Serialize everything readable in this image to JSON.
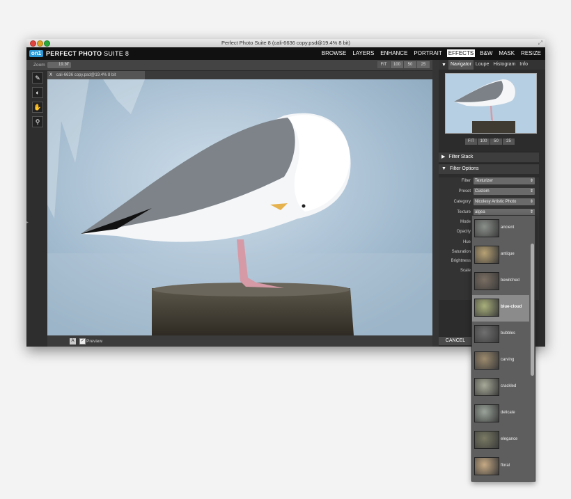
{
  "window": {
    "title": "Perfect Photo Suite 8 (cali-6636 copy.psd@19.4% 8 bit)"
  },
  "app": {
    "logo_mark": "on1",
    "name_bold": "PERFECT PHOTO",
    "name_light": "SUITE 8"
  },
  "modules": [
    "BROWSE",
    "LAYERS",
    "ENHANCE",
    "PORTRAIT",
    "EFFECTS",
    "B&W",
    "MASK",
    "RESIZE"
  ],
  "active_module": "EFFECTS",
  "toolbar": {
    "zoom_label": "Zoom",
    "zoom_value": "19.37",
    "zoom_buttons": [
      "FIT",
      "100",
      "50",
      "25"
    ]
  },
  "document": {
    "close": "X",
    "tab_label": "cali-6636 copy.psd@19.4% 8 bit"
  },
  "status": {
    "view_button": "A",
    "preview_check": "✓",
    "preview_label": "Preview"
  },
  "navigator": {
    "tabs": [
      "Navigator",
      "Loupe",
      "Histogram",
      "Info"
    ],
    "zoom_buttons": [
      "FIT",
      "100",
      "50",
      "25"
    ]
  },
  "filter_stack": {
    "label": "Filter Stack"
  },
  "filter_options": {
    "label": "Filter Options",
    "filter_label": "Filter",
    "filter_value": "Texturizer",
    "preset_label": "Preset",
    "preset_value": "Custom",
    "category_label": "Category",
    "category_value": "Nicolesy Artistic Photo",
    "texture_label": "Texture",
    "texture_value": "algea",
    "mode_label": "Mode",
    "opacity_label": "Opacity",
    "hue_label": "Hue",
    "saturation_label": "Saturation",
    "brightness_label": "Brightness",
    "scale_label": "Scale"
  },
  "footer": {
    "cancel": "CANCEL"
  },
  "texture_dropdown": {
    "selected": "blue-cloud",
    "items": [
      {
        "name": "ancient",
        "color": "#8a8f8a"
      },
      {
        "name": "antique",
        "color": "#b8a274"
      },
      {
        "name": "bewitched",
        "color": "#7a6e62"
      },
      {
        "name": "blue-cloud",
        "color": "#a9b07a"
      },
      {
        "name": "bubbles",
        "color": "#6f6f6f"
      },
      {
        "name": "carving",
        "color": "#9c8a6d"
      },
      {
        "name": "crackled",
        "color": "#a7aa98"
      },
      {
        "name": "delicate",
        "color": "#9aa39a"
      },
      {
        "name": "elegance",
        "color": "#7a7a64"
      },
      {
        "name": "floral",
        "color": "#c6aa84"
      }
    ]
  },
  "colors": {
    "accent": "#2c9ad8",
    "active_module_bg": "#ffffff",
    "menubar": "#111111"
  }
}
